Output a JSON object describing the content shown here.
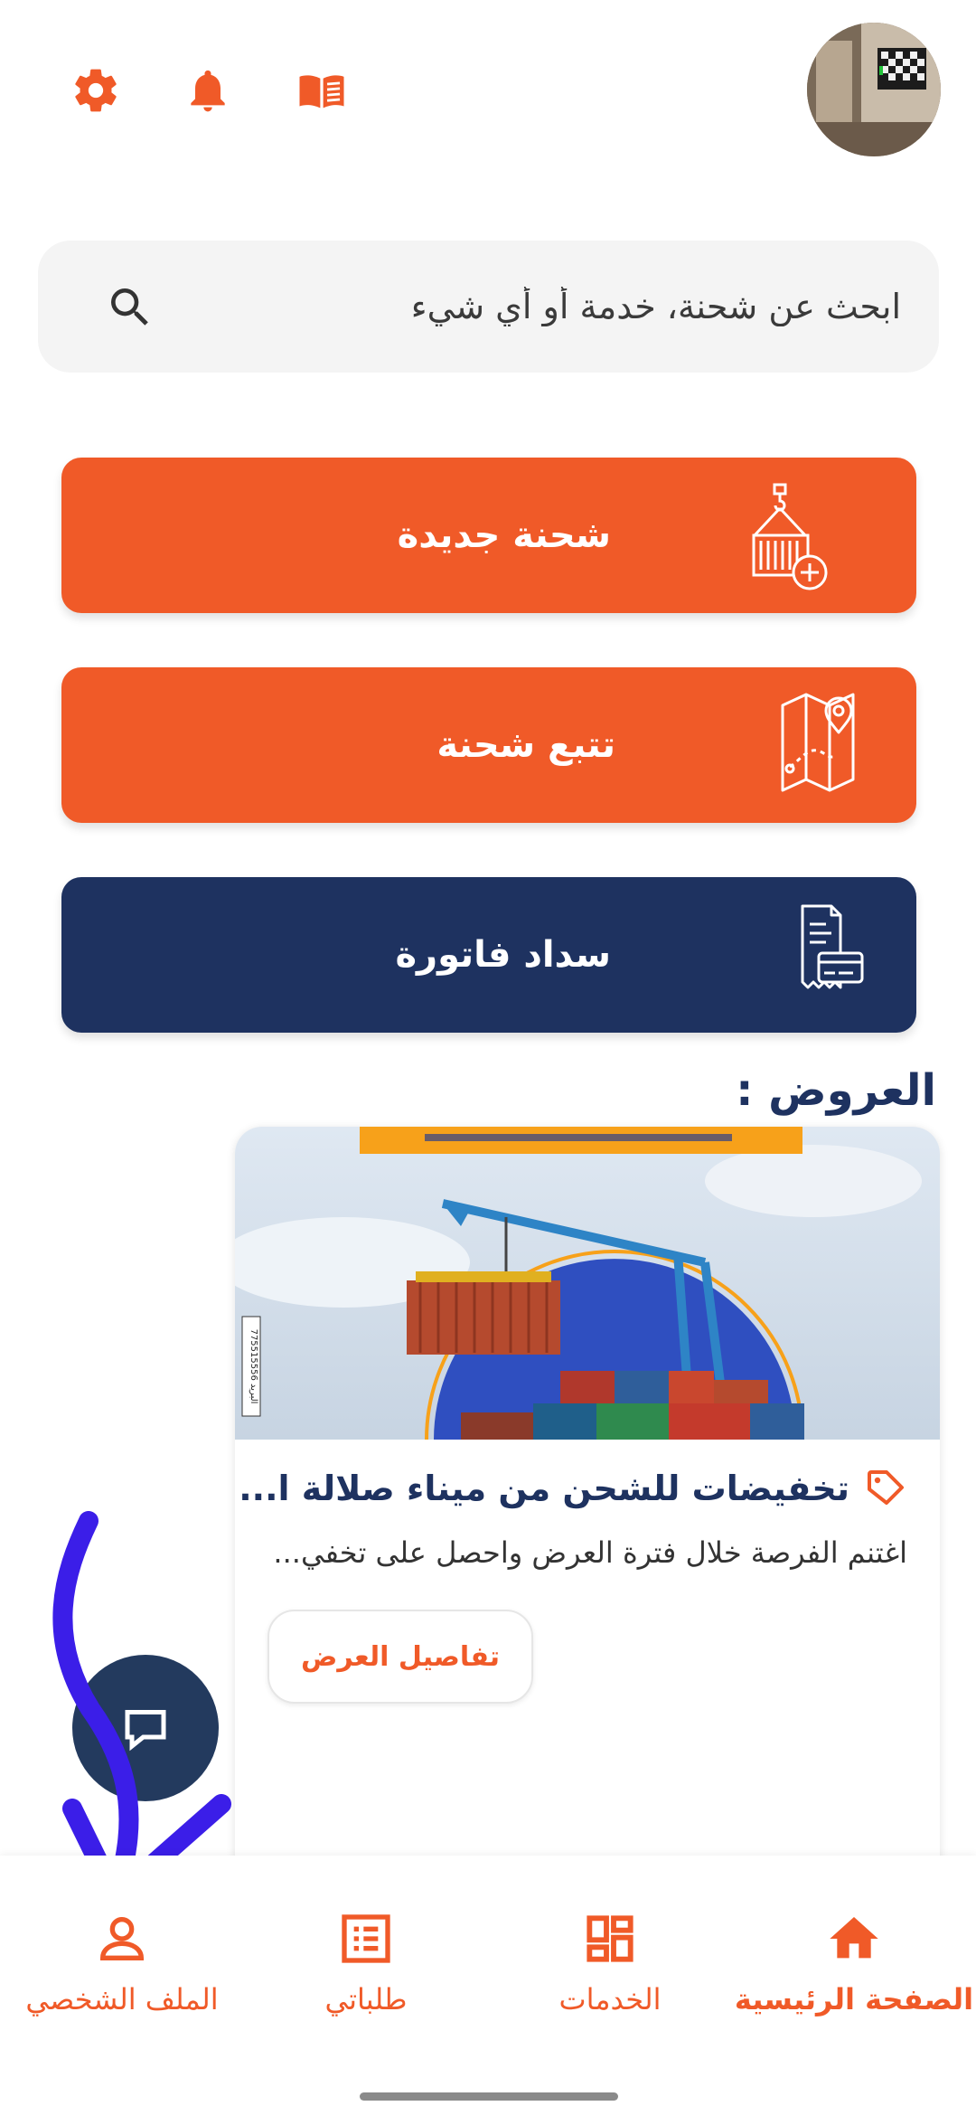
{
  "header": {
    "icons": [
      "settings-gear-icon",
      "notification-bell-icon",
      "book-open-icon"
    ],
    "avatar_alt": "profile-photo"
  },
  "search": {
    "placeholder": "ابحث عن شحنة، خدمة أو أي شيء",
    "icon": "search-icon"
  },
  "actions": [
    {
      "label": "شحنة جديدة",
      "icon": "container-crane-plus-icon",
      "color": "#f05a28"
    },
    {
      "label": "تتبع شحنة",
      "icon": "map-pin-route-icon",
      "color": "#f05a28"
    },
    {
      "label": "سداد فاتورة",
      "icon": "invoice-card-icon",
      "color": "#1e3260"
    }
  ],
  "offers": {
    "title": "العروض :",
    "card": {
      "title": "تخفيضات للشحن من ميناء صلالة ا...",
      "description": "اغتنم الفرصة خلال فترة العرض واحصل على تخفي...",
      "button": "تفاصيل العرض",
      "image_side_text": "البريد 775515556"
    }
  },
  "bottom_nav": {
    "items": [
      {
        "label": "الصفحة الرئيسية",
        "icon": "home-icon",
        "active": true
      },
      {
        "label": "الخدمات",
        "icon": "grid-icon",
        "active": false
      },
      {
        "label": "طلباتي",
        "icon": "list-document-icon",
        "active": false
      },
      {
        "label": "الملف الشخصي",
        "icon": "person-icon",
        "active": false
      }
    ]
  },
  "colors": {
    "brand_orange": "#f05a28",
    "brand_navy": "#1e3260",
    "annotation_arrow": "#3b1ee8"
  }
}
